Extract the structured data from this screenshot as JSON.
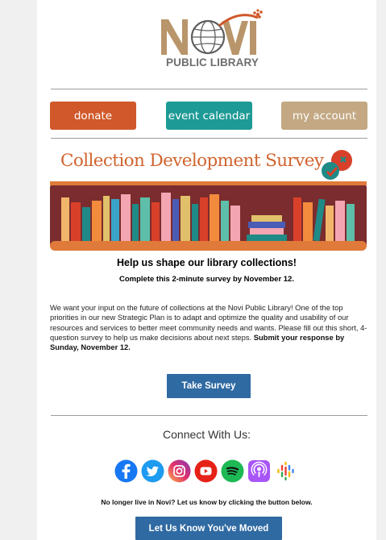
{
  "logo": {
    "word": "NOVI",
    "subtitle": "PUBLIC LIBRARY"
  },
  "nav": {
    "donate": "donate",
    "event_calendar": "event calendar",
    "my_account": "my account"
  },
  "banner": {
    "title": "Collection Development Survey"
  },
  "headline": "Help us shape our library collections!",
  "subheadline": "Complete this 2-minute survey by November 12.",
  "body": {
    "text": "We want your input on the future of collections at the Novi Public Library! One of the top priorities in our new Strategic Plan is to adapt and optimize the quality and usability of our resources and services to better meet community needs and wants. Please fill out this short, 4-question survey to help us make decisions about next steps. ",
    "bold": "Submit your response by Sunday, November 12."
  },
  "survey_button": "Take Survey",
  "connect_heading": "Connect With Us:",
  "social_icons": [
    "facebook-icon",
    "twitter-icon",
    "instagram-icon",
    "youtube-icon",
    "spotify-icon",
    "podcasts-icon",
    "google-podcasts-icon"
  ],
  "moved_note": "No longer live in Novi? Let us know by clicking the button below.",
  "moved_button": "Let Us Know You've Moved",
  "colors": {
    "donate": "#d0582a",
    "event": "#1d9a95",
    "account": "#c3a883",
    "cta": "#2f6aa2",
    "banner_title": "#d1642e"
  }
}
